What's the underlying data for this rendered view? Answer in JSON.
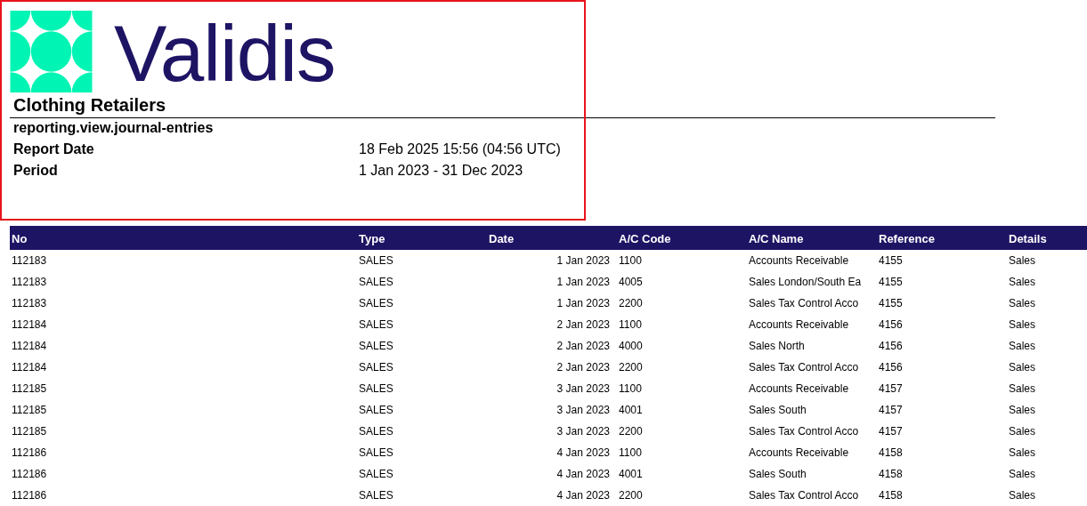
{
  "logo": {
    "text": "Validis"
  },
  "company": "Clothing Retailers",
  "report_name": "reporting.view.journal-entries",
  "fields": [
    {
      "label": "Report Date",
      "value": "18 Feb 2025 15:56 (04:56 UTC)"
    },
    {
      "label": "Period",
      "value": "1 Jan 2023 - 31 Dec 2023"
    }
  ],
  "table": {
    "columns": [
      "No",
      "Type",
      "Date",
      "A/C Code",
      "A/C Name",
      "Reference",
      "Details"
    ],
    "rows": [
      [
        "112183",
        "SALES",
        "1 Jan 2023",
        "1100",
        "Accounts Receivable",
        "4155",
        "Sales"
      ],
      [
        "112183",
        "SALES",
        "1 Jan 2023",
        "4005",
        "Sales London/South Ea",
        "4155",
        "Sales"
      ],
      [
        "112183",
        "SALES",
        "1 Jan 2023",
        "2200",
        "Sales Tax Control Acco",
        "4155",
        "Sales"
      ],
      [
        "112184",
        "SALES",
        "2 Jan 2023",
        "1100",
        "Accounts Receivable",
        "4156",
        "Sales"
      ],
      [
        "112184",
        "SALES",
        "2 Jan 2023",
        "4000",
        "Sales North",
        "4156",
        "Sales"
      ],
      [
        "112184",
        "SALES",
        "2 Jan 2023",
        "2200",
        "Sales Tax Control Acco",
        "4156",
        "Sales"
      ],
      [
        "112185",
        "SALES",
        "3 Jan 2023",
        "1100",
        "Accounts Receivable",
        "4157",
        "Sales"
      ],
      [
        "112185",
        "SALES",
        "3 Jan 2023",
        "4001",
        "Sales South",
        "4157",
        "Sales"
      ],
      [
        "112185",
        "SALES",
        "3 Jan 2023",
        "2200",
        "Sales Tax Control Acco",
        "4157",
        "Sales"
      ],
      [
        "112186",
        "SALES",
        "4 Jan 2023",
        "1100",
        "Accounts Receivable",
        "4158",
        "Sales"
      ],
      [
        "112186",
        "SALES",
        "4 Jan 2023",
        "4001",
        "Sales South",
        "4158",
        "Sales"
      ],
      [
        "112186",
        "SALES",
        "4 Jan 2023",
        "2200",
        "Sales Tax Control Acco",
        "4158",
        "Sales"
      ]
    ]
  }
}
